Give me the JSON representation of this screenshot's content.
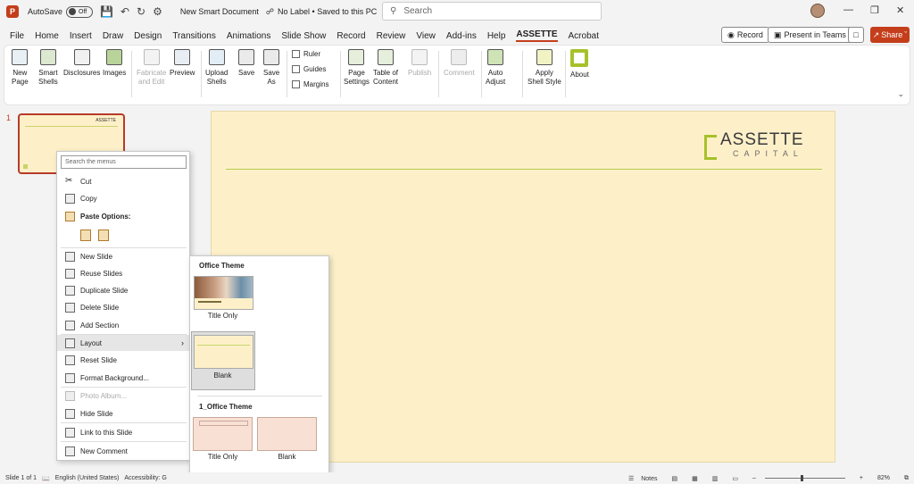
{
  "titlebar": {
    "autosave_label": "AutoSave",
    "autosave_state": "Off",
    "document_name": "New Smart Document",
    "label_status": "No Label • Saved to this PC",
    "search_placeholder": "Search"
  },
  "menu": {
    "tabs": [
      "File",
      "Home",
      "Insert",
      "Draw",
      "Design",
      "Transitions",
      "Animations",
      "Slide Show",
      "Record",
      "Review",
      "View",
      "Add-ins",
      "Help",
      "ASSETTE",
      "Acrobat"
    ],
    "active_tab": "ASSETTE",
    "record_label": "Record",
    "present_label": "Present in Teams",
    "share_label": "Share"
  },
  "ribbon": {
    "new_page": "New\nPage",
    "smart_shells": "Smart\nShells",
    "disclosures": "Disclosures",
    "images": "Images",
    "fabricate": "Fabricate\nand Edit",
    "preview": "Preview",
    "upload_shells": "Upload\nShells",
    "save": "Save",
    "save_as": "Save\nAs",
    "ruler": "Ruler",
    "guides": "Guides",
    "margins": "Margins",
    "page_settings": "Page\nSettings",
    "table_of_content": "Table of\nContent",
    "publish": "Publish",
    "comment": "Comment",
    "auto_adjust": "Auto\nAdjust",
    "apply_shell_style": "Apply\nShell Style",
    "about": "About"
  },
  "slides_panel": {
    "slide_number": "1"
  },
  "slide": {
    "logo_line1": "ASSETTE",
    "logo_line2": "CAPITAL"
  },
  "context_menu": {
    "search_placeholder": "Search the menus",
    "cut": "Cut",
    "copy": "Copy",
    "paste_options": "Paste Options:",
    "new_slide": "New Slide",
    "reuse_slides": "Reuse Slides",
    "duplicate_slide": "Duplicate Slide",
    "delete_slide": "Delete Slide",
    "add_section": "Add Section",
    "layout": "Layout",
    "reset_slide": "Reset Slide",
    "format_background": "Format Background...",
    "photo_album": "Photo Album...",
    "hide_slide": "Hide Slide",
    "link_to_slide": "Link to this Slide",
    "new_comment": "New Comment"
  },
  "layout_submenu": {
    "group1": "Office Theme",
    "group1_items": [
      "Title Only",
      "Blank"
    ],
    "group2": "1_Office Theme",
    "group2_items": [
      "Title Only",
      "Blank"
    ]
  },
  "statusbar": {
    "slide_info": "Slide 1 of 1",
    "language": "English (United States)",
    "accessibility": "Accessibility: G",
    "notes": "Notes",
    "zoom": "82%"
  },
  "colors": {
    "accent": "#c43e1c",
    "slide_bg": "#fdf0c9",
    "logo_green": "#a6c12a"
  }
}
